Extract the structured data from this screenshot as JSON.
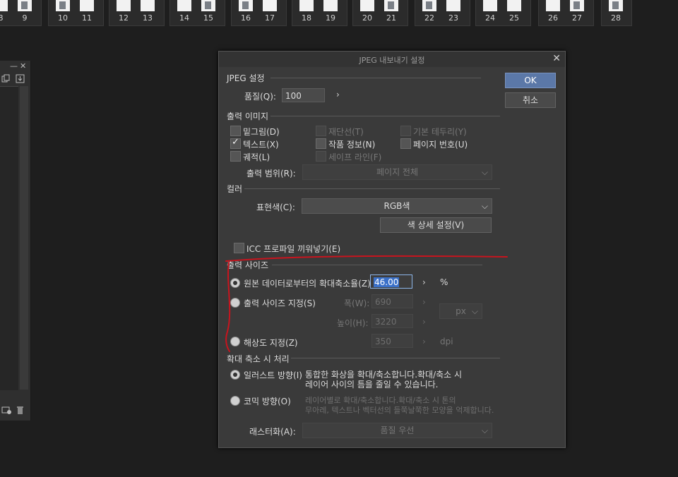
{
  "page_strip": [
    {
      "pages": [
        "8",
        "9"
      ]
    },
    {
      "pages": [
        "10",
        "11"
      ]
    },
    {
      "pages": [
        "12",
        "13"
      ]
    },
    {
      "pages": [
        "14",
        "15"
      ]
    },
    {
      "pages": [
        "16",
        "17"
      ]
    },
    {
      "pages": [
        "18",
        "19"
      ]
    },
    {
      "pages": [
        "20",
        "21"
      ]
    },
    {
      "pages": [
        "22",
        "23"
      ]
    },
    {
      "pages": [
        "24",
        "25"
      ]
    },
    {
      "pages": [
        "26",
        "27"
      ]
    },
    {
      "pages": [
        "28"
      ]
    }
  ],
  "side_panel": {
    "minimize": "—",
    "close": "✕"
  },
  "dialog": {
    "title": "JPEG 내보내기 설정",
    "close": "✕",
    "ok": "OK",
    "cancel": "취소",
    "jpeg": {
      "section": "JPEG 설정",
      "quality_label": "품질(Q):",
      "quality_value": "100",
      "arrow": "›"
    },
    "output_image": {
      "section": "출력 이미지",
      "sketch": "밑그림(D)",
      "crop_marks": "재단선(T)",
      "default_border": "기본 테두리(Y)",
      "text": "텍스트(X)",
      "work_info": "작품 정보(N)",
      "page_number": "페이지 번호(U)",
      "grid": "궤적(L)",
      "safe_line": "세이프 라인(F)",
      "range_label": "출력 범위(R):",
      "range_value": "페이지 전체"
    },
    "color": {
      "section": "컬러",
      "mode_label": "표현색(C):",
      "mode_value": "RGB색",
      "detail_button": "색 상세 설정(V)",
      "icc": "ICC 프로파일 끼워넣기(E)"
    },
    "output_size": {
      "section": "출력 사이즈",
      "scale_label": "원본 데이터로부터의 확대축소율(Z)",
      "scale_value": "46.00",
      "scale_unit": "%",
      "size_label": "출력 사이즈 지정(S)",
      "width_label": "폭(W):",
      "width_value": "690",
      "height_label": "높이(H):",
      "height_value": "3220",
      "unit_value": "px",
      "resolution_label": "해상도 지정(Z)",
      "resolution_value": "350",
      "resolution_unit": "dpi"
    },
    "scaling": {
      "section": "확대 축소 시 처리",
      "illust_label": "일러스트 방향(I)",
      "illust_desc_1": "통합한 화상을 확대/축소합니다.확대/축소 시",
      "illust_desc_2": "레이어 사이의 틈을 줄일 수 있습니다.",
      "comic_label": "코믹 방향(O)",
      "comic_desc_1": "레이어별로 확대/축소합니다.확대/축소 시 톤의",
      "comic_desc_2": "무아레, 텍스트나 벡터선의 들쭉날쭉한 모양을 억제합니다.",
      "raster_label": "래스터화(A):",
      "raster_value": "품질 우선"
    }
  },
  "colors": {
    "annotation_red": "#c8141e",
    "ok_button": "#5b78a8"
  }
}
